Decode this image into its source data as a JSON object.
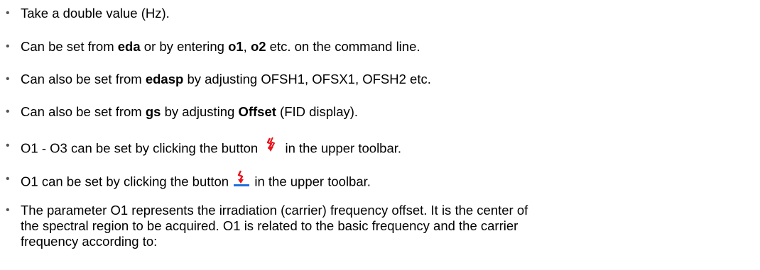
{
  "items": [
    {
      "text": "Take a double value (Hz)."
    },
    {
      "t1": "Can be set from ",
      "b1": "eda",
      "t2": " or by entering ",
      "b2": "o1",
      "t3": ", ",
      "b3": "o2",
      "t4": " etc. on the command line."
    },
    {
      "t1": "Can also be set from ",
      "b1": "edasp",
      "t2": " by adjusting OFSH1, OFSX1, OFSH2 etc."
    },
    {
      "t1": "Can also be set from ",
      "b1": "gs",
      "t2": " by adjusting ",
      "b2": "Offset",
      "t3": " (FID display)."
    },
    {
      "t1": "O1 - O3 can be set by clicking the button ",
      "icon": "frequency-offset-o1-o3-icon",
      "t2": " in the upper toolbar."
    },
    {
      "t1": "O1 can be set by clicking the button ",
      "icon": "frequency-offset-o1-icon",
      "t2": " in the upper toolbar."
    },
    {
      "lines": [
        "The parameter O1 represents the irradiation (carrier) frequency offset. It is the center of",
        "the spectral region to be acquired. O1 is related to the basic frequency and the carrier",
        "frequency according to:"
      ]
    }
  ],
  "bullet_char": "•",
  "colors": {
    "text": "#000000",
    "bullet": "#555555",
    "icon_red": "#e8141c",
    "icon_blue": "#1e6fd9"
  }
}
